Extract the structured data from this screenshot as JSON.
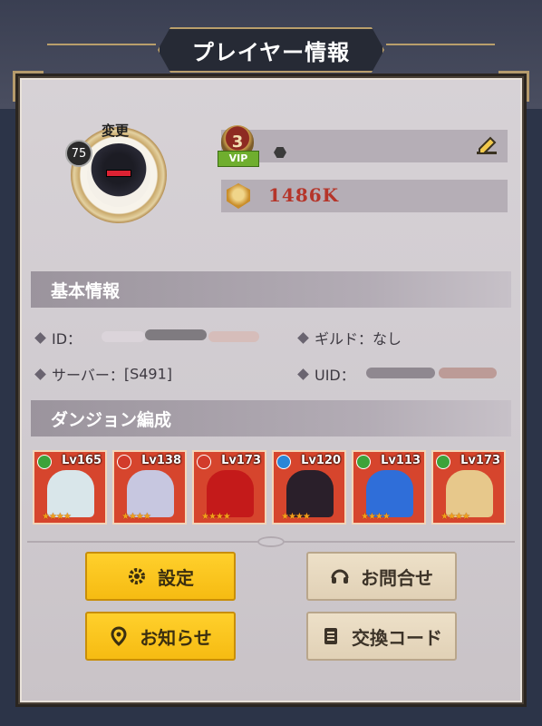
{
  "header": {
    "title": "プレイヤー情報"
  },
  "profile": {
    "level": "75",
    "change_label": "変更",
    "vip_level": "3",
    "vip_label": "VIP",
    "power": "1486K"
  },
  "basic_info": {
    "section_title": "基本情報",
    "id_label": "ID：",
    "guild_label": "ギルド：",
    "guild_value": "なし",
    "server_label": "サーバー：",
    "server_value": "[S491]",
    "uid_label": "UID："
  },
  "dungeon": {
    "section_title": "ダンジョン編成",
    "characters": [
      {
        "level": "Lv165",
        "element_color": "#3da23a",
        "figure_color": "#d9e6ea"
      },
      {
        "level": "Lv138",
        "element_color": "#d23b2b",
        "figure_color": "#c7c7e0"
      },
      {
        "level": "Lv173",
        "element_color": "#d23b2b",
        "figure_color": "#c41a1a"
      },
      {
        "level": "Lv120",
        "element_color": "#2b86d6",
        "figure_color": "#2a1f2a"
      },
      {
        "level": "Lv113",
        "element_color": "#3da23a",
        "figure_color": "#2f6ed9"
      },
      {
        "level": "Lv173",
        "element_color": "#3da23a",
        "figure_color": "#e7c88b"
      }
    ],
    "stars": "★★★★"
  },
  "buttons": {
    "settings": "設定",
    "contact": "お問合せ",
    "notice": "お知らせ",
    "exchange_code": "交換コード"
  },
  "colors": {
    "yellow_button": "#f6bb12",
    "beige_button": "#e1d1b6",
    "power_text": "#b5352a",
    "card_background": "#d6452d"
  }
}
